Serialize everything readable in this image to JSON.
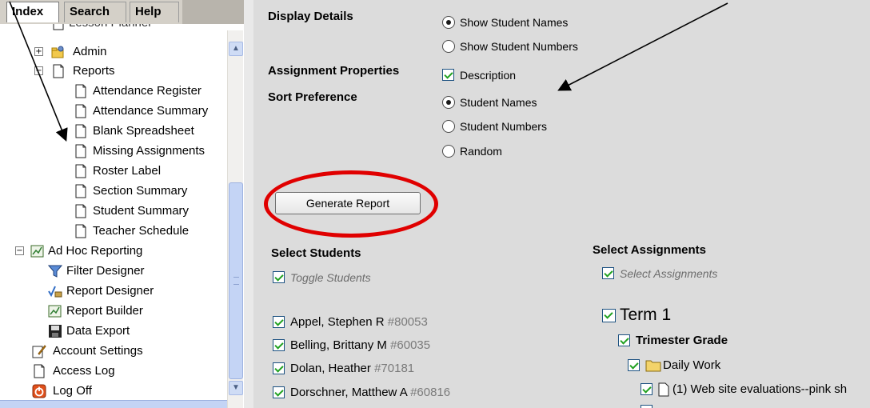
{
  "tabs": {
    "index": "Index",
    "search": "Search",
    "help": "Help"
  },
  "tree": {
    "partial_top": "Lesson Planner",
    "admin": "Admin",
    "reports": "Reports",
    "report_items": [
      "Attendance Register",
      "Attendance Summary",
      "Blank Spreadsheet",
      "Missing Assignments",
      "Roster Label",
      "Section Summary",
      "Student Summary",
      "Teacher Schedule"
    ],
    "adhoc": "Ad Hoc Reporting",
    "adhoc_items": [
      "Filter Designer",
      "Report Designer",
      "Report Builder",
      "Data Export"
    ],
    "account_settings": "Account Settings",
    "access_log": "Access Log",
    "log_off": "Log Off"
  },
  "form": {
    "display_details_label": "Display Details",
    "display_opts": [
      "Show Student Names",
      "Show Student Numbers"
    ],
    "assignment_props_label": "Assignment Properties",
    "description_label": "Description",
    "sort_pref_label": "Sort Preference",
    "sort_opts": [
      "Student Names",
      "Student Numbers",
      "Random"
    ],
    "generate_label": "Generate Report"
  },
  "students": {
    "header": "Select Students",
    "toggle": "Toggle Students",
    "list": [
      {
        "name": "Appel, Stephen R",
        "id": "#80053"
      },
      {
        "name": "Belling, Brittany M",
        "id": "#60035"
      },
      {
        "name": "Dolan, Heather",
        "id": "#70181"
      },
      {
        "name": "Dorschner, Matthew A",
        "id": "#60816"
      }
    ]
  },
  "assignments": {
    "header": "Select Assignments",
    "select_all": "Select Assignments",
    "term": "Term 1",
    "grade": "Trimester Grade",
    "folder": "Daily Work",
    "item": "(1) Web site evaluations--pink sh"
  },
  "colors": {
    "annotation": "#e00000",
    "check": "#21a121",
    "main_bg": "#dcdcdc"
  }
}
